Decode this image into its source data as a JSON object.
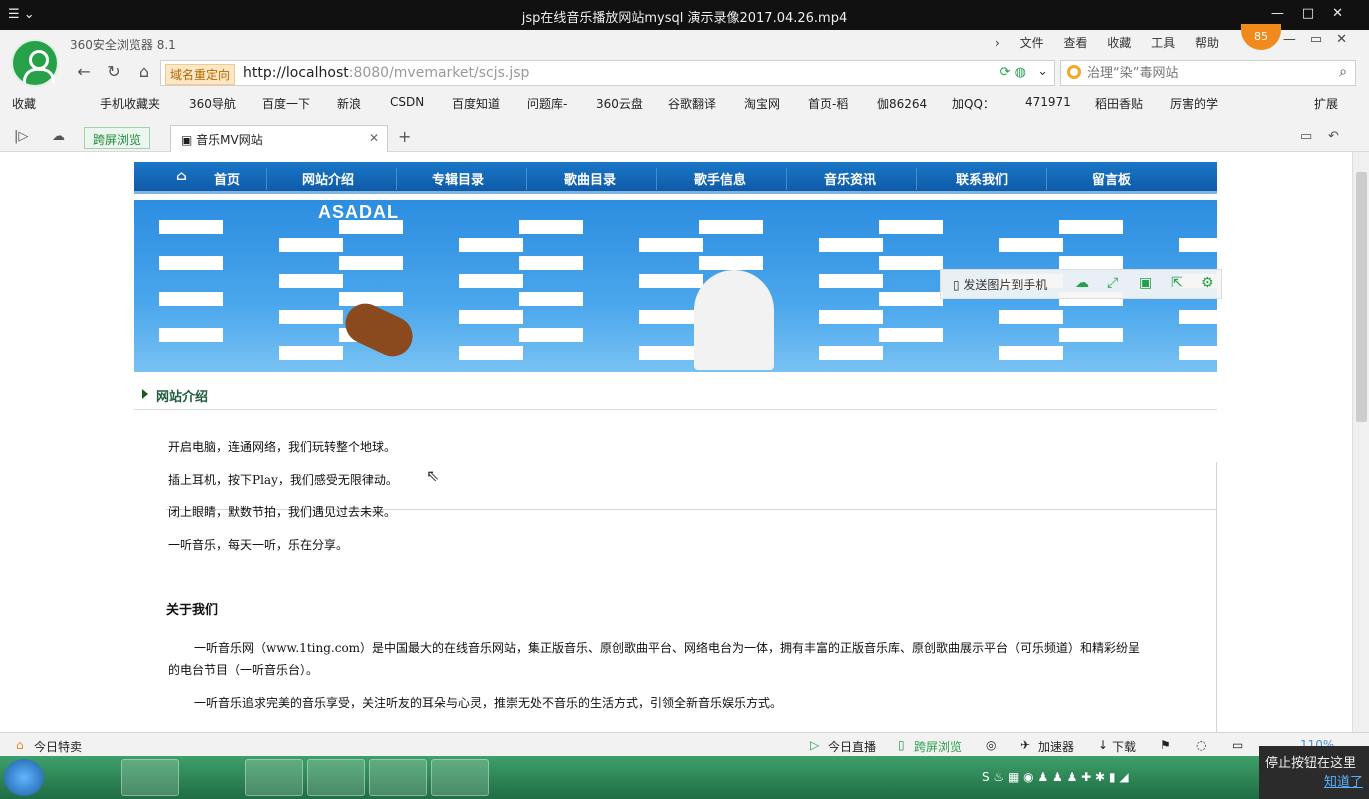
{
  "player": {
    "title": "jsp在线音乐播放网站mysql 演示录像2017.04.26.mp4",
    "menu_icon": "menu-icon",
    "controls": [
      "minimize-icon",
      "restore-icon",
      "close-icon"
    ]
  },
  "browser": {
    "name": "360安全浏览器 8.1",
    "badge": "85",
    "menu": [
      "文件",
      "查看",
      "收藏",
      "工具",
      "帮助"
    ],
    "redirect_tag": "域名重定向",
    "url_host": "http://localhost",
    "url_rest": ":8080/mvemarket/scjs.jsp",
    "search_placeholder": "治理“染”毒网站",
    "bookmarks": [
      "收藏",
      "手机收藏夹",
      "360导航",
      "百度一下",
      "新浪",
      "CSDN",
      "百度知道",
      "问题库-",
      "360云盘",
      "谷歌翻译",
      "淘宝网",
      "首页-稻",
      "伽86264",
      "加QQ：",
      "471971",
      "稻田香贴",
      "厉害的学"
    ],
    "extend": "扩展",
    "tabs": {
      "split_view": "跨屏浏览",
      "active_tab": "音乐MV网站"
    }
  },
  "site": {
    "nav": [
      "首页",
      "网站介绍",
      "专辑目录",
      "歌曲目录",
      "歌手信息",
      "音乐资讯",
      "联系我们",
      "留言板"
    ],
    "banner_logo": "ASADAL",
    "float_toolbar": {
      "send_label": "发送图片到手机"
    },
    "section_title": "网站介绍",
    "intro_lines": [
      "开启电脑，连通网络，我们玩转整个地球。",
      "插上耳机，按下Play，我们感受无限律动。",
      "闭上眼睛，默数节拍，我们遇见过去未来。",
      "一听音乐，每天一听，乐在分享。"
    ],
    "about_title": "关于我们",
    "about_p1": "一听音乐网（www.1ting.com）是中国最大的在线音乐网站，集正版音乐、原创歌曲平台、网络电台为一体，拥有丰富的正版音乐库、原创歌曲展示平台（可乐频道）和精彩纷呈",
    "about_p1b": "的电台节目（一听音乐台）。",
    "about_p2": "一听音乐追求完美的音乐享受，关注听友的耳朵与心灵，推崇无处不音乐的生活方式，引领全新音乐娱乐方式。"
  },
  "statusbar": {
    "today_deals": "今日特卖",
    "live": "今日直播",
    "split": "跨屏浏览",
    "accelerator": "加速器",
    "download": "下载",
    "zoom": "110%"
  },
  "notice": {
    "text": "停止按钮在这里",
    "link": "知道了"
  },
  "colors": {
    "nav_blue": "#1a78c7",
    "brand_green": "#27a04a",
    "taskbar_green": "#2e8a57"
  }
}
